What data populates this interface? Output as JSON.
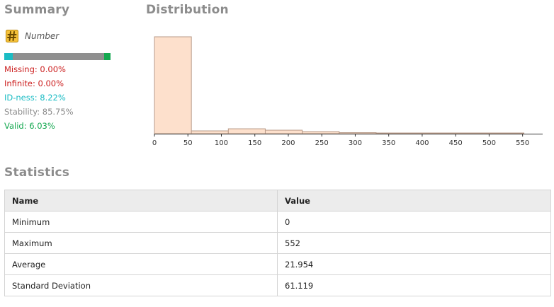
{
  "summary": {
    "title": "Summary",
    "type_label": "Number",
    "type_icon": "hash-icon",
    "quality_bar": [
      {
        "name": "id-ness",
        "fraction": 0.0822,
        "color": "#1bbcc4"
      },
      {
        "name": "stability-rest",
        "fraction": 0.8578,
        "color": "#8f8f8f"
      },
      {
        "name": "valid",
        "fraction": 0.06,
        "color": "#13a84f"
      }
    ],
    "metrics": [
      {
        "text": "Missing: 0.00%",
        "color": "#cc1f1f"
      },
      {
        "text": "Infinite: 0.00%",
        "color": "#cc1f1f"
      },
      {
        "text": "ID-ness: 8.22%",
        "color": "#1bbcc4"
      },
      {
        "text": "Stability: 85.75%",
        "color": "#8a8a8a"
      },
      {
        "text": "Valid: 6.03%",
        "color": "#13a84f"
      }
    ]
  },
  "distribution": {
    "title": "Distribution"
  },
  "chart_data": {
    "type": "bar",
    "title": "",
    "xlabel": "",
    "ylabel": "",
    "x_ticks": [
      0,
      50,
      100,
      150,
      200,
      250,
      300,
      350,
      400,
      450,
      500,
      550
    ],
    "xlim": [
      0,
      580
    ],
    "bins": [
      {
        "start": 0,
        "end": 55.2,
        "count": 276
      },
      {
        "start": 55.2,
        "end": 110.4,
        "count": 8
      },
      {
        "start": 110.4,
        "end": 165.6,
        "count": 14
      },
      {
        "start": 165.6,
        "end": 220.8,
        "count": 10
      },
      {
        "start": 220.8,
        "end": 276,
        "count": 6
      },
      {
        "start": 276,
        "end": 331.2,
        "count": 3
      },
      {
        "start": 331.2,
        "end": 386.4,
        "count": 1
      },
      {
        "start": 386.4,
        "end": 441.6,
        "count": 0
      },
      {
        "start": 441.6,
        "end": 496.8,
        "count": 0
      },
      {
        "start": 496.8,
        "end": 552,
        "count": 1
      }
    ],
    "ylim": [
      0,
      276
    ],
    "bar_fill": "#fde0cc",
    "bar_stroke": "#b89a88",
    "grid": false
  },
  "statistics": {
    "title": "Statistics",
    "columns": [
      "Name",
      "Value"
    ],
    "rows": [
      [
        "Minimum",
        "0"
      ],
      [
        "Maximum",
        "552"
      ],
      [
        "Average",
        "21.954"
      ],
      [
        "Standard Deviation",
        "61.119"
      ]
    ]
  }
}
